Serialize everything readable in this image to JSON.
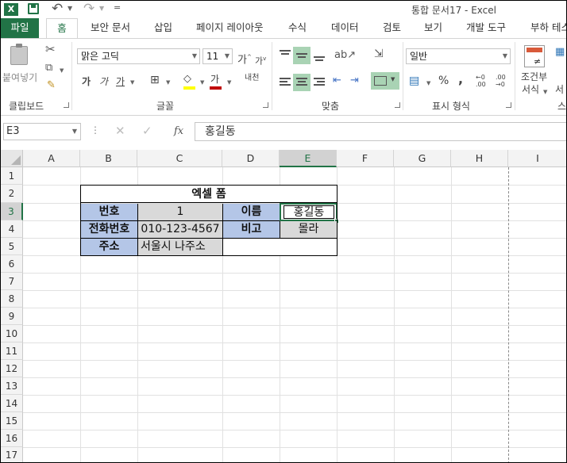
{
  "window": {
    "title": "통합 문서17 - Excel",
    "app_icon": "X"
  },
  "quick_access": {
    "icons": [
      "save-icon",
      "undo-icon",
      "redo-icon",
      "customize-icon"
    ],
    "more_glyph": "="
  },
  "ribbon_tabs": [
    "파일",
    "홈",
    "보안 문서",
    "삽입",
    "페이지 레이아웃",
    "수식",
    "데이터",
    "검토",
    "보기",
    "개발 도구",
    "부하 테스"
  ],
  "active_tab": "홈",
  "clipboard": {
    "paste_label": "붙여넣기",
    "group_label": "클립보드"
  },
  "font": {
    "font_name": "맑은 고딕",
    "font_size": "11",
    "increase_label": "가",
    "decrease_label": "가",
    "bold_label": "가",
    "italic_label": "가",
    "underline_label": "가",
    "font_color_label": "가",
    "phonetic_label": "내천",
    "group_label": "글꼴",
    "font_color": "#c00000",
    "fill_color": "#ffff00"
  },
  "alignment": {
    "group_label": "맞춤"
  },
  "number": {
    "format": "일반",
    "percent_label": "%",
    "comma_label": ",",
    "inc_decimal": "←0 .00",
    "dec_decimal": ".00 →0",
    "group_label": "표시 형식"
  },
  "styles": {
    "cond_label_line1": "조건부",
    "cond_label_line2": "서식",
    "partial_label1": "서",
    "partial_label2": "스"
  },
  "formula_bar": {
    "name_box": "E3",
    "formula": "홍길동",
    "fx": "fx"
  },
  "columns": [
    "A",
    "B",
    "C",
    "D",
    "E",
    "F",
    "G",
    "H",
    "I"
  ],
  "rows": [
    "1",
    "2",
    "3",
    "4",
    "5",
    "6",
    "7",
    "8",
    "9",
    "10",
    "11",
    "12",
    "13",
    "14",
    "15",
    "16",
    "17"
  ],
  "active_column": "E",
  "active_row": "3",
  "form": {
    "title": "엑셀 폼",
    "label_number": "번호",
    "value_number": "1",
    "label_name": "이름",
    "value_name": "홍길동",
    "label_phone": "전화번호",
    "value_phone": "010-123-4567",
    "label_note": "비고",
    "value_note": "몰라",
    "label_address": "주소",
    "value_address": "서울시 나주소"
  },
  "colors": {
    "accent": "#217346",
    "label_fill": "#b4c6e7",
    "value_fill": "#d9d9d9"
  }
}
